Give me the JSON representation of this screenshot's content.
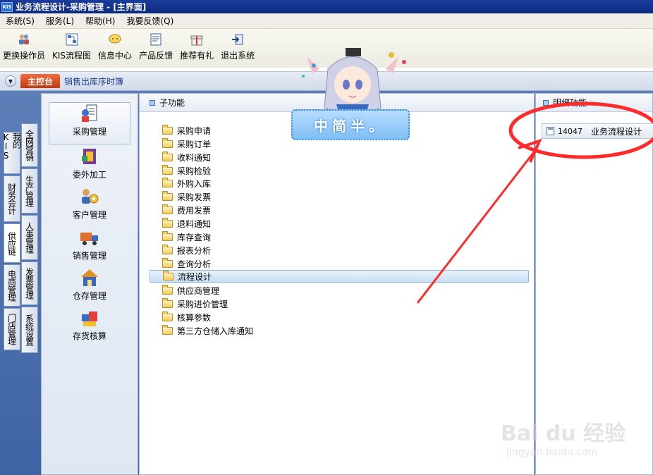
{
  "window": {
    "title": "业务流程设计-采购管理 - [主界面]",
    "logo_text": "KIS"
  },
  "menubar": {
    "items": [
      "系统(S)",
      "服务(L)",
      "帮助(H)",
      "我要反馈(Q)"
    ]
  },
  "toolbar": {
    "buttons": [
      {
        "label": "更换操作员",
        "icon": "users-icon"
      },
      {
        "label": "KIS流程图",
        "icon": "flowchart-icon"
      },
      {
        "label": "信息中心",
        "icon": "message-icon"
      },
      {
        "label": "产品反馈",
        "icon": "feedback-icon"
      },
      {
        "label": "推荐有礼",
        "icon": "gift-icon"
      },
      {
        "label": "退出系统",
        "icon": "exit-icon"
      }
    ]
  },
  "tabs": {
    "main": "主控台",
    "other": "销售出库序时簿"
  },
  "vtabs": {
    "left": [
      "我的KIS",
      "财务会计",
      "供应链",
      "电商管理",
      "门店管理"
    ],
    "right": [
      "全网营销",
      "生产管理",
      "人事管理",
      "发票管理",
      "系统设置"
    ],
    "active": "供应链"
  },
  "categories": [
    {
      "label": "采购管理",
      "icon": "purchase-icon",
      "selected": true
    },
    {
      "label": "委外加工",
      "icon": "outsourcing-icon"
    },
    {
      "label": "客户管理",
      "icon": "customer-icon"
    },
    {
      "label": "销售管理",
      "icon": "sales-truck-icon"
    },
    {
      "label": "仓存管理",
      "icon": "warehouse-icon"
    },
    {
      "label": "存货核算",
      "icon": "inventory-icon"
    }
  ],
  "subfunctions": {
    "header": "子功能",
    "items": [
      "采购申请",
      "采购订单",
      "收料通知",
      "采购检验",
      "外购入库",
      "采购发票",
      "费用发票",
      "退料通知",
      "库存查询",
      "报表分析",
      "查询分析",
      "流程设计",
      "供应商管理",
      "采购进价管理",
      "核算参数",
      "第三方仓储入库通知"
    ],
    "selected": "流程设计"
  },
  "details": {
    "header": "明细功能",
    "items": [
      {
        "code": "14047",
        "label": "业务流程设计"
      }
    ]
  },
  "mascot": {
    "banner_text": "中简半。"
  },
  "watermark": {
    "brand": "Bai du 经验",
    "url": "jingyan.baidu.com"
  },
  "colors": {
    "title_bar": "#0a2a80",
    "tab_active": "#e05a28",
    "annotation": "#ff2a2a",
    "workarea": "#4f72b0"
  }
}
